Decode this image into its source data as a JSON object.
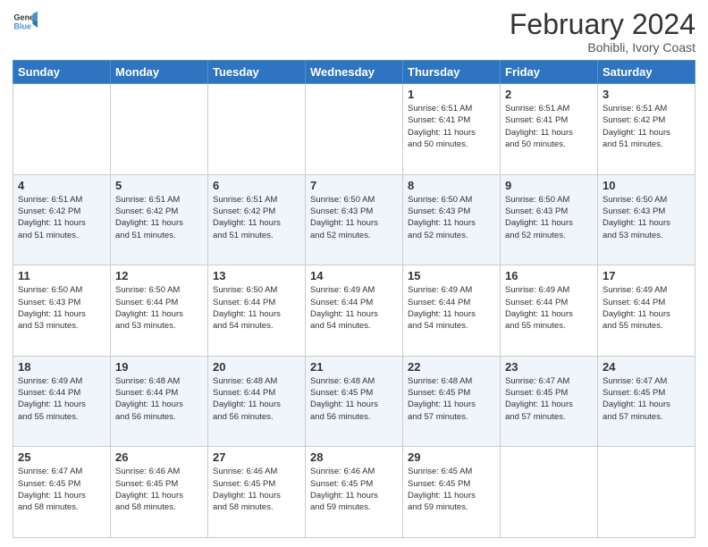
{
  "header": {
    "logo_general": "General",
    "logo_blue": "Blue",
    "month_title": "February 2024",
    "subtitle": "Bohibli, Ivory Coast"
  },
  "days_of_week": [
    "Sunday",
    "Monday",
    "Tuesday",
    "Wednesday",
    "Thursday",
    "Friday",
    "Saturday"
  ],
  "weeks": [
    [
      {
        "day": "",
        "info": ""
      },
      {
        "day": "",
        "info": ""
      },
      {
        "day": "",
        "info": ""
      },
      {
        "day": "",
        "info": ""
      },
      {
        "day": "1",
        "info": "Sunrise: 6:51 AM\nSunset: 6:41 PM\nDaylight: 11 hours\nand 50 minutes."
      },
      {
        "day": "2",
        "info": "Sunrise: 6:51 AM\nSunset: 6:41 PM\nDaylight: 11 hours\nand 50 minutes."
      },
      {
        "day": "3",
        "info": "Sunrise: 6:51 AM\nSunset: 6:42 PM\nDaylight: 11 hours\nand 51 minutes."
      }
    ],
    [
      {
        "day": "4",
        "info": "Sunrise: 6:51 AM\nSunset: 6:42 PM\nDaylight: 11 hours\nand 51 minutes."
      },
      {
        "day": "5",
        "info": "Sunrise: 6:51 AM\nSunset: 6:42 PM\nDaylight: 11 hours\nand 51 minutes."
      },
      {
        "day": "6",
        "info": "Sunrise: 6:51 AM\nSunset: 6:42 PM\nDaylight: 11 hours\nand 51 minutes."
      },
      {
        "day": "7",
        "info": "Sunrise: 6:50 AM\nSunset: 6:43 PM\nDaylight: 11 hours\nand 52 minutes."
      },
      {
        "day": "8",
        "info": "Sunrise: 6:50 AM\nSunset: 6:43 PM\nDaylight: 11 hours\nand 52 minutes."
      },
      {
        "day": "9",
        "info": "Sunrise: 6:50 AM\nSunset: 6:43 PM\nDaylight: 11 hours\nand 52 minutes."
      },
      {
        "day": "10",
        "info": "Sunrise: 6:50 AM\nSunset: 6:43 PM\nDaylight: 11 hours\nand 53 minutes."
      }
    ],
    [
      {
        "day": "11",
        "info": "Sunrise: 6:50 AM\nSunset: 6:43 PM\nDaylight: 11 hours\nand 53 minutes."
      },
      {
        "day": "12",
        "info": "Sunrise: 6:50 AM\nSunset: 6:44 PM\nDaylight: 11 hours\nand 53 minutes."
      },
      {
        "day": "13",
        "info": "Sunrise: 6:50 AM\nSunset: 6:44 PM\nDaylight: 11 hours\nand 54 minutes."
      },
      {
        "day": "14",
        "info": "Sunrise: 6:49 AM\nSunset: 6:44 PM\nDaylight: 11 hours\nand 54 minutes."
      },
      {
        "day": "15",
        "info": "Sunrise: 6:49 AM\nSunset: 6:44 PM\nDaylight: 11 hours\nand 54 minutes."
      },
      {
        "day": "16",
        "info": "Sunrise: 6:49 AM\nSunset: 6:44 PM\nDaylight: 11 hours\nand 55 minutes."
      },
      {
        "day": "17",
        "info": "Sunrise: 6:49 AM\nSunset: 6:44 PM\nDaylight: 11 hours\nand 55 minutes."
      }
    ],
    [
      {
        "day": "18",
        "info": "Sunrise: 6:49 AM\nSunset: 6:44 PM\nDaylight: 11 hours\nand 55 minutes."
      },
      {
        "day": "19",
        "info": "Sunrise: 6:48 AM\nSunset: 6:44 PM\nDaylight: 11 hours\nand 56 minutes."
      },
      {
        "day": "20",
        "info": "Sunrise: 6:48 AM\nSunset: 6:44 PM\nDaylight: 11 hours\nand 56 minutes."
      },
      {
        "day": "21",
        "info": "Sunrise: 6:48 AM\nSunset: 6:45 PM\nDaylight: 11 hours\nand 56 minutes."
      },
      {
        "day": "22",
        "info": "Sunrise: 6:48 AM\nSunset: 6:45 PM\nDaylight: 11 hours\nand 57 minutes."
      },
      {
        "day": "23",
        "info": "Sunrise: 6:47 AM\nSunset: 6:45 PM\nDaylight: 11 hours\nand 57 minutes."
      },
      {
        "day": "24",
        "info": "Sunrise: 6:47 AM\nSunset: 6:45 PM\nDaylight: 11 hours\nand 57 minutes."
      }
    ],
    [
      {
        "day": "25",
        "info": "Sunrise: 6:47 AM\nSunset: 6:45 PM\nDaylight: 11 hours\nand 58 minutes."
      },
      {
        "day": "26",
        "info": "Sunrise: 6:46 AM\nSunset: 6:45 PM\nDaylight: 11 hours\nand 58 minutes."
      },
      {
        "day": "27",
        "info": "Sunrise: 6:46 AM\nSunset: 6:45 PM\nDaylight: 11 hours\nand 58 minutes."
      },
      {
        "day": "28",
        "info": "Sunrise: 6:46 AM\nSunset: 6:45 PM\nDaylight: 11 hours\nand 59 minutes."
      },
      {
        "day": "29",
        "info": "Sunrise: 6:45 AM\nSunset: 6:45 PM\nDaylight: 11 hours\nand 59 minutes."
      },
      {
        "day": "",
        "info": ""
      },
      {
        "day": "",
        "info": ""
      }
    ]
  ]
}
